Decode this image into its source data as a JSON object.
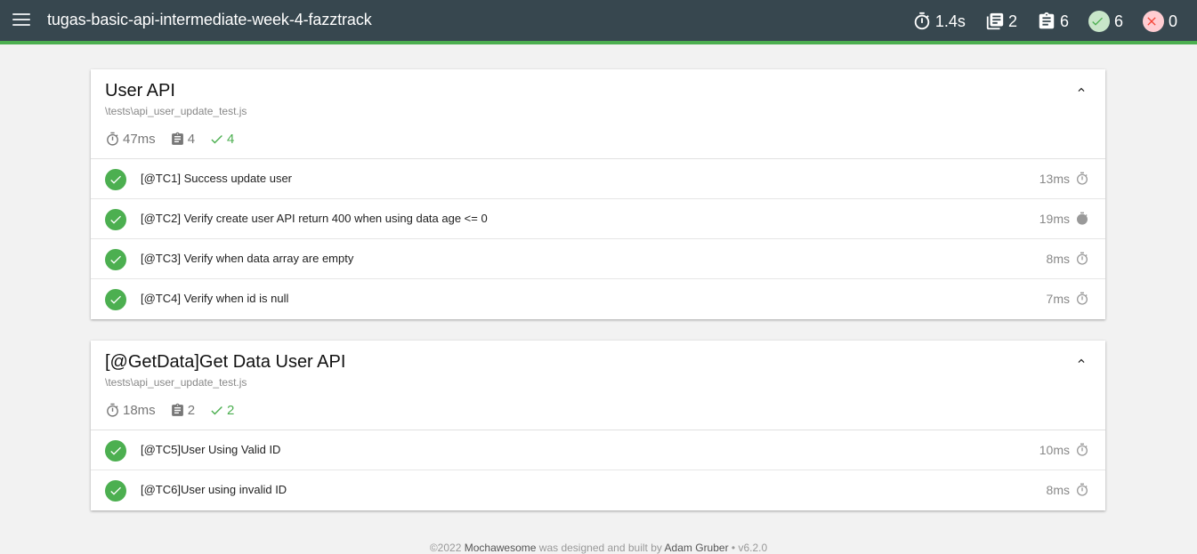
{
  "navbar": {
    "title": "tugas-basic-api-intermediate-week-4-fazztrack",
    "menu_icon": "hamburger-menu-icon",
    "stats": {
      "duration": "1.4s",
      "suites": "2",
      "tests": "6",
      "passes": "6",
      "failures": "0"
    },
    "colors": {
      "bar": "#37474f",
      "accent": "#4caf50",
      "pass_bg": "#c8e6c9",
      "fail_bg": "#ffcdd2"
    }
  },
  "suites": [
    {
      "title": "User API",
      "file": "\\tests\\api_user_update_test.js",
      "summary": {
        "duration": "47ms",
        "tests": "4",
        "passes": "4"
      },
      "tests": [
        {
          "title": "[@TC1] Success update user",
          "duration": "13ms"
        },
        {
          "title": "[@TC2] Verify create user API return 400 when using data age <= 0",
          "duration": "19ms"
        },
        {
          "title": "[@TC3] Verify when data array are empty",
          "duration": "8ms"
        },
        {
          "title": "[@TC4] Verify when id is null",
          "duration": "7ms"
        }
      ]
    },
    {
      "title": "[@GetData]Get Data User API",
      "file": "\\tests\\api_user_update_test.js",
      "summary": {
        "duration": "18ms",
        "tests": "2",
        "passes": "2"
      },
      "tests": [
        {
          "title": "[@TC5]User Using Valid ID",
          "duration": "10ms"
        },
        {
          "title": "[@TC6]User using invalid ID",
          "duration": "8ms"
        }
      ]
    }
  ],
  "footer": {
    "copyright": "©2022",
    "product": "Mochawesome",
    "middle": "was designed and built by",
    "author": "Adam Gruber",
    "version": "• v6.2.0"
  }
}
